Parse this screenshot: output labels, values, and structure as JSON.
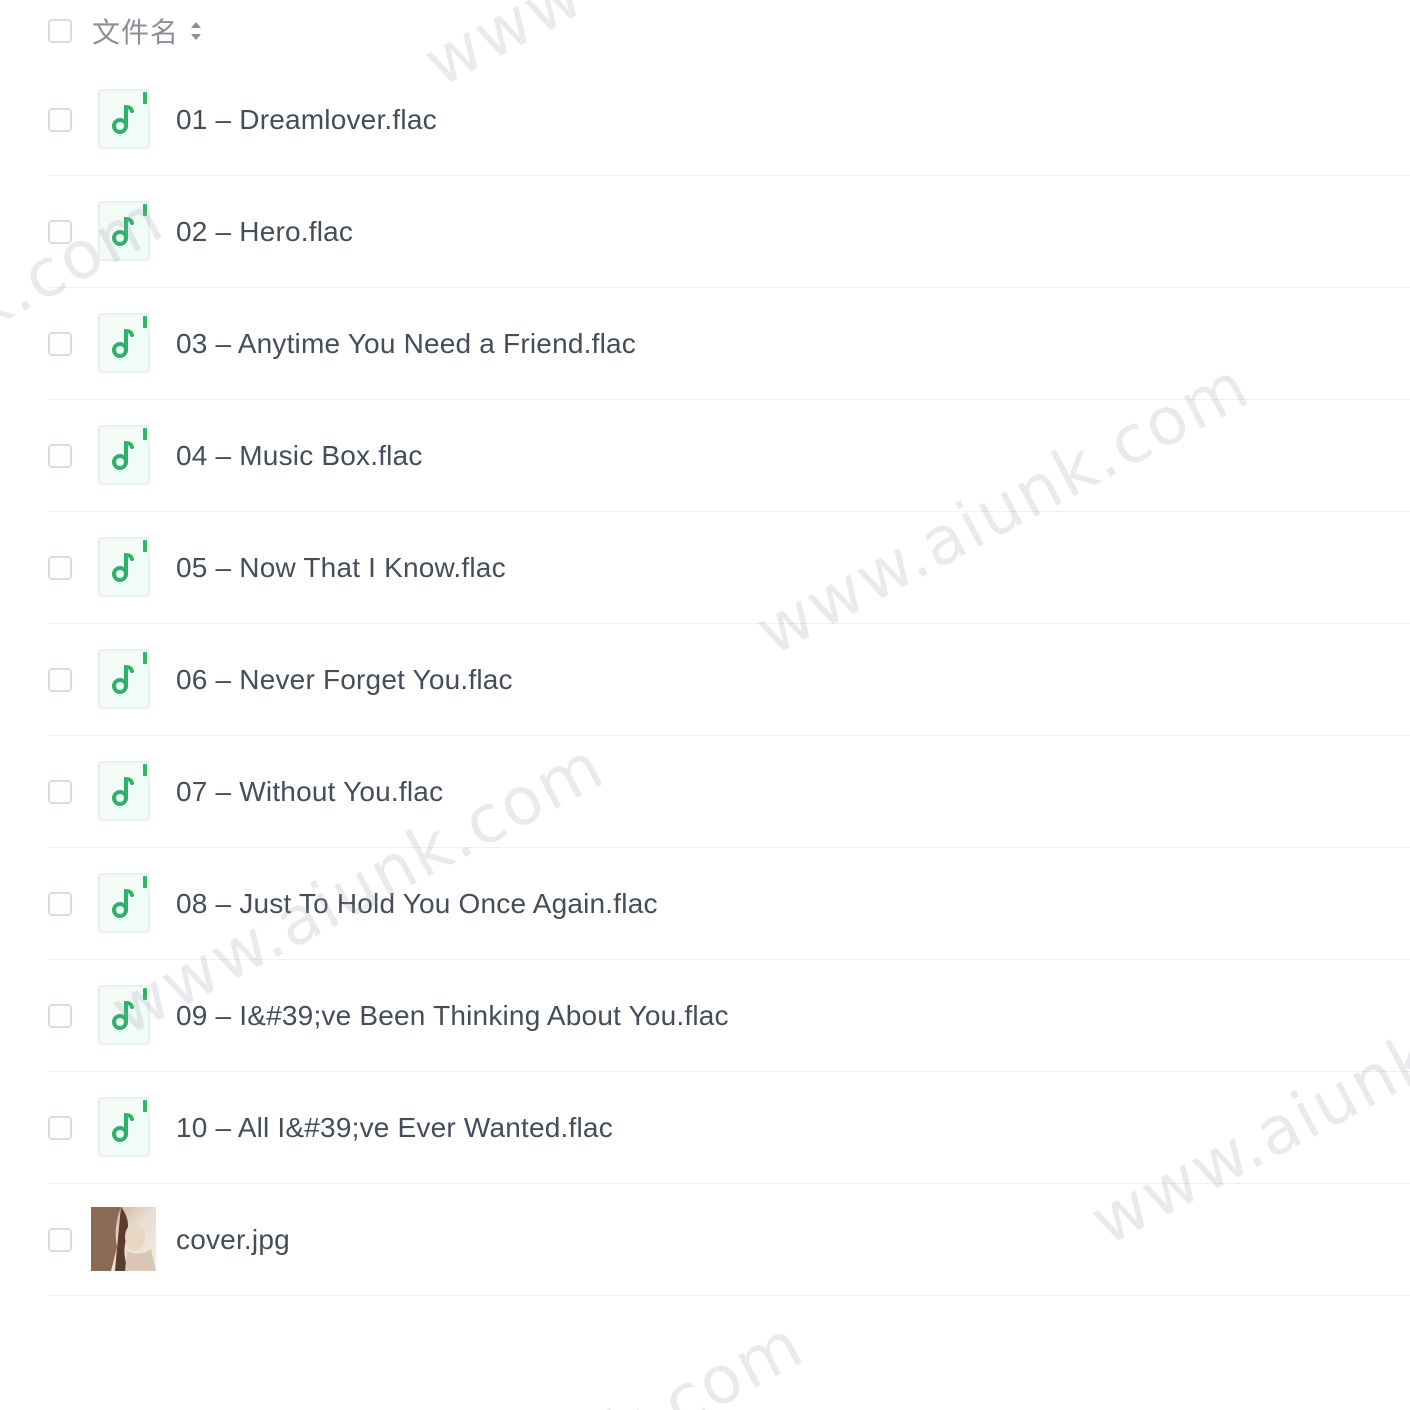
{
  "header": {
    "column_label": "文件名",
    "sort_icon": "sort-updown-icon"
  },
  "files": [
    {
      "name": "01 – Dreamlover.flac",
      "type": "audio",
      "icon": "music-note-icon"
    },
    {
      "name": "02 – Hero.flac",
      "type": "audio",
      "icon": "music-note-icon"
    },
    {
      "name": "03 – Anytime You Need a Friend.flac",
      "type": "audio",
      "icon": "music-note-icon"
    },
    {
      "name": "04 – Music Box.flac",
      "type": "audio",
      "icon": "music-note-icon"
    },
    {
      "name": "05 – Now That I Know.flac",
      "type": "audio",
      "icon": "music-note-icon"
    },
    {
      "name": "06 – Never Forget You.flac",
      "type": "audio",
      "icon": "music-note-icon"
    },
    {
      "name": "07 – Without You.flac",
      "type": "audio",
      "icon": "music-note-icon"
    },
    {
      "name": "08 – Just To Hold You Once Again.flac",
      "type": "audio",
      "icon": "music-note-icon"
    },
    {
      "name": "09 – I&#39;ve Been Thinking About You.flac",
      "type": "audio",
      "icon": "music-note-icon"
    },
    {
      "name": "10 – All I&#39;ve Ever Wanted.flac",
      "type": "audio",
      "icon": "music-note-icon"
    },
    {
      "name": "cover.jpg",
      "type": "image",
      "icon": "image-thumbnail"
    }
  ],
  "watermarks": [
    "www.aiunk.com",
    "www.aiunk.com",
    "www.aiunk.com",
    "k.com",
    "www",
    "k.com"
  ],
  "colors": {
    "accent_green": "#2fb36b",
    "icon_bg": "#f3fbf6",
    "text": "#454d5a",
    "header_text": "#8a9099",
    "divider": "#eef0f3",
    "checkbox_border": "#d7dbe2"
  }
}
